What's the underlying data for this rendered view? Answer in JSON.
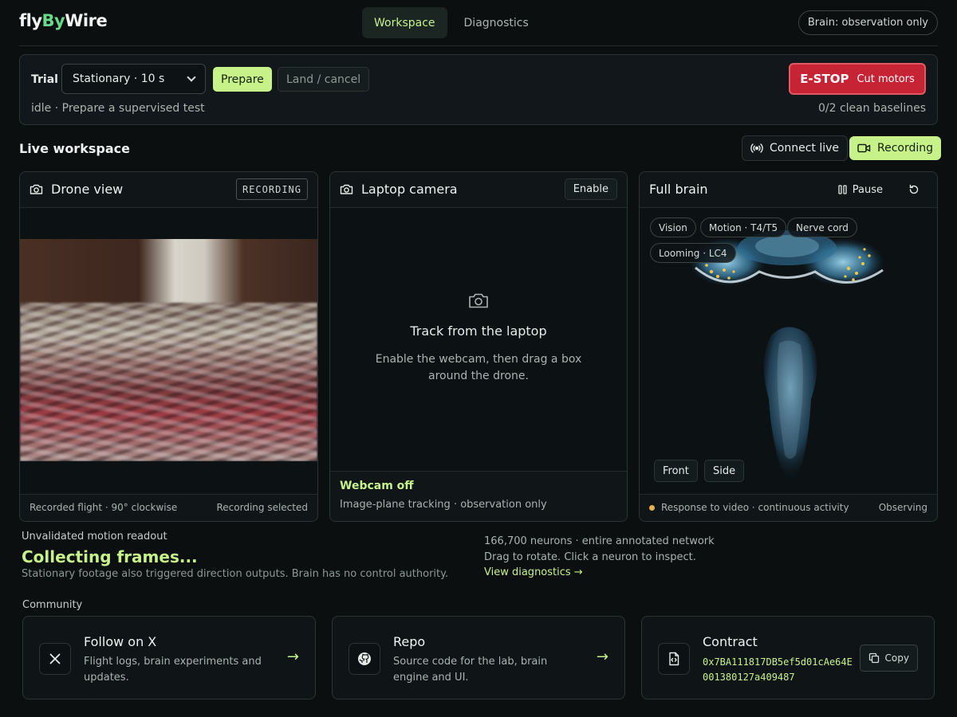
{
  "header": {
    "logo_a": "fly",
    "logo_b": "By",
    "logo_c": "Wire",
    "tabs": [
      {
        "label": "Workspace"
      },
      {
        "label": "Diagnostics"
      }
    ],
    "brain_mode": "Brain: observation only"
  },
  "trial": {
    "label": "Trial",
    "selected": "Stationary · 10 s",
    "prepare": "Prepare",
    "land": "Land / cancel",
    "status": "idle · Prepare a supervised test",
    "estop_main": "E-STOP",
    "estop_sub": "Cut motors",
    "baselines": "0/2 clean baselines"
  },
  "workspace": {
    "title": "Live workspace",
    "connect": "Connect live",
    "recording": "Recording"
  },
  "drone": {
    "title": "Drone view",
    "badge": "RECORDING",
    "foot_left": "Recorded flight · 90° clockwise",
    "foot_right": "Recording selected"
  },
  "laptop": {
    "title": "Laptop camera",
    "enable": "Enable",
    "center_title": "Track from the laptop",
    "center_sub1": "Enable the webcam, then drag a box",
    "center_sub2": "around the drone.",
    "status": "Webcam off",
    "status_sub": "Image-plane tracking · observation only"
  },
  "brain": {
    "title": "Full brain",
    "pause": "Pause",
    "chips": [
      "Vision",
      "Motion · T4/T5",
      "Nerve cord",
      "Looming · LC4"
    ],
    "views": [
      "Front",
      "Side"
    ],
    "foot_left": "Response to video · continuous activity",
    "foot_right": "Observing"
  },
  "readout": {
    "caption": "Unvalidated motion readout",
    "big": "Collecting frames...",
    "sub": "Stationary footage also triggered direction outputs. Brain has no control authority."
  },
  "stats": {
    "line1": "166,700 neurons · entire annotated network",
    "line2": "Drag to rotate. Click a neuron to inspect.",
    "link": "View diagnostics →"
  },
  "community": {
    "label": "Community",
    "x_title": "Follow on X",
    "x_desc": "Flight logs, brain experiments and updates.",
    "repo_title": "Repo",
    "repo_desc": "Source code for the lab, brain engine and UI.",
    "contract_title": "Contract",
    "contract_addr": "0x7BA111817DB5ef5d01cAe64E001380127a409487",
    "copy": "Copy",
    "arrow": "→"
  },
  "colors": {
    "accent": "#c7f28a",
    "brand_green": "#69d98a",
    "estop_red": "#c62335",
    "status_dot": "#e8b34e"
  }
}
